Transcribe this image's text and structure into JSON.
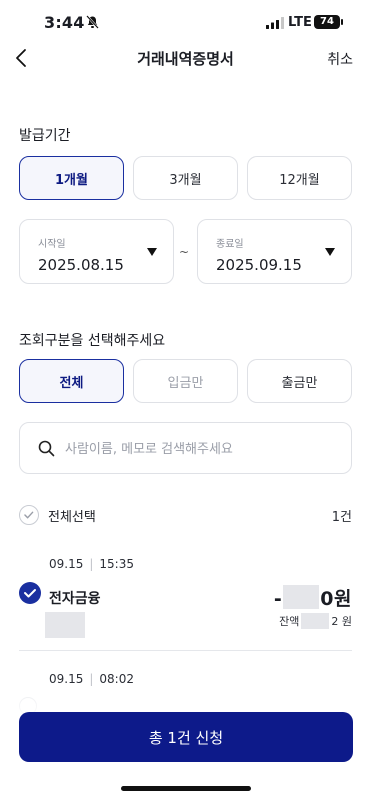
{
  "status": {
    "time": "3:44",
    "network": "LTE",
    "battery": "74"
  },
  "nav": {
    "title": "거래내역증명서",
    "cancel_label": "취소"
  },
  "period": {
    "label": "발급기간",
    "options": [
      "1개월",
      "3개월",
      "12개월"
    ],
    "selected": "1개월",
    "start_caption": "시작일",
    "start_date": "2025.08.15",
    "separator": "~",
    "end_caption": "종료일",
    "end_date": "2025.09.15"
  },
  "type_filter": {
    "label": "조회구분을 선택해주세요",
    "options": [
      "전체",
      "입금만",
      "출금만"
    ],
    "selected": "전체"
  },
  "search": {
    "placeholder": "사람이름, 메모로 검색해주세요",
    "value": ""
  },
  "list": {
    "select_all_label": "전체선택",
    "count_label": "1건",
    "items": [
      {
        "date": "09.15",
        "time": "15:35",
        "name": "전자금융",
        "amount": "-",
        "amount_suffix": "0원",
        "balance_prefix": "잔액",
        "balance_suffix": "2 원",
        "checked": true
      },
      {
        "date": "09.15",
        "time": "08:02"
      }
    ]
  },
  "cta": {
    "label": "총 1건 신청"
  },
  "colors": {
    "primary": "#0d1a8a",
    "accent_border": "#1a2fa0",
    "border": "#dfe1e6"
  },
  "icons": [
    "bell-off-icon",
    "signal-icon",
    "back-icon",
    "caret-down-icon",
    "search-icon",
    "check-icon"
  ]
}
